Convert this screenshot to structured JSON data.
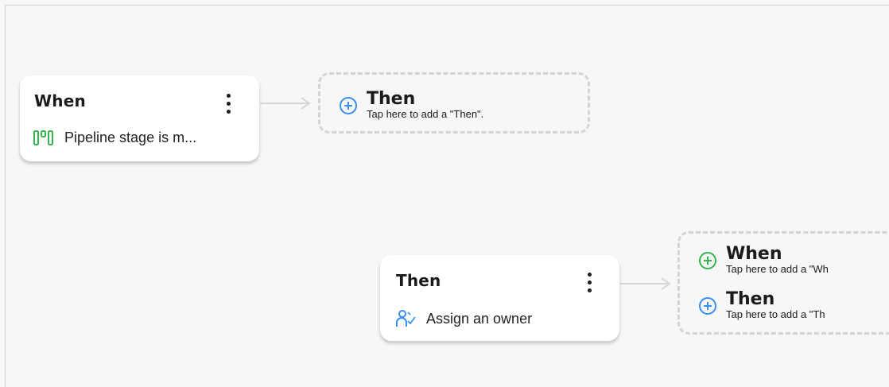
{
  "colors": {
    "connector": "#d6d6d6",
    "plus_blue": "#3b8ff0",
    "plus_green": "#34b44a",
    "pipeline_icon": "#34b44a",
    "owner_icon": "#3b8ff0"
  },
  "trigger_card": {
    "title": "When",
    "icon": "pipeline-icon",
    "label": "Pipeline stage is m..."
  },
  "add_then_1": {
    "title": "Then",
    "hint": "Tap here to add a \"Then\"."
  },
  "action_card": {
    "title": "Then",
    "icon": "assign-owner-icon",
    "label": "Assign an owner"
  },
  "add_group_2": {
    "when_title": "When",
    "when_hint": "Tap here to add a \"Wh",
    "then_title": "Then",
    "then_hint": "Tap here to add a \"Th"
  }
}
